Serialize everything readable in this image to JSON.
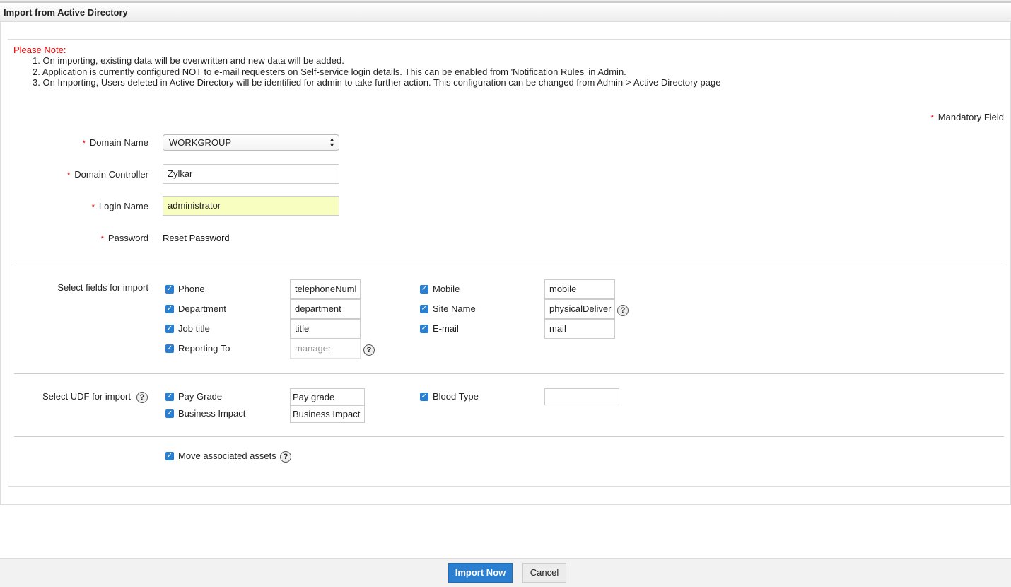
{
  "title": "Import from Active Directory",
  "note": {
    "heading": "Please Note:",
    "items": [
      "1. On importing, existing data will be overwritten and new data will be added.",
      "2. Application is currently configured NOT to e-mail requesters on Self-service login details. This can be enabled from 'Notification Rules' in Admin.",
      "3. On Importing, Users deleted in Active Directory will be identified for admin to take further action. This configuration can be changed from Admin-> Active Directory page"
    ]
  },
  "mandatory": "Mandatory Field",
  "form": {
    "domain_name_label": "Domain Name",
    "domain_name_value": "WORKGROUP",
    "controller_label": "Domain Controller",
    "controller_value": "Zylkar",
    "login_label": "Login Name",
    "login_value": "administrator",
    "password_label": "Password",
    "reset_password": "Reset Password"
  },
  "fields": {
    "label": "Select fields for import",
    "items": [
      {
        "label": "Phone",
        "value": "telephoneNuml"
      },
      {
        "label": "Department",
        "value": "department"
      },
      {
        "label": "Job title",
        "value": "title"
      },
      {
        "label": "Reporting To",
        "value": "manager"
      },
      {
        "label": "Mobile",
        "value": "mobile"
      },
      {
        "label": "Site Name",
        "value": "physicalDeliver"
      },
      {
        "label": "E-mail",
        "value": "mail"
      }
    ]
  },
  "udf": {
    "label": "Select UDF for import",
    "items": [
      {
        "label": "Pay Grade",
        "value": "Pay grade"
      },
      {
        "label": "Business Impact",
        "value": "Business Impact"
      },
      {
        "label": "Blood Type",
        "value": ""
      }
    ]
  },
  "move_assets": "Move associated assets",
  "buttons": {
    "import": "Import Now",
    "cancel": "Cancel"
  },
  "colors": {
    "primary": "#2a7fd0",
    "required": "#e00000"
  }
}
